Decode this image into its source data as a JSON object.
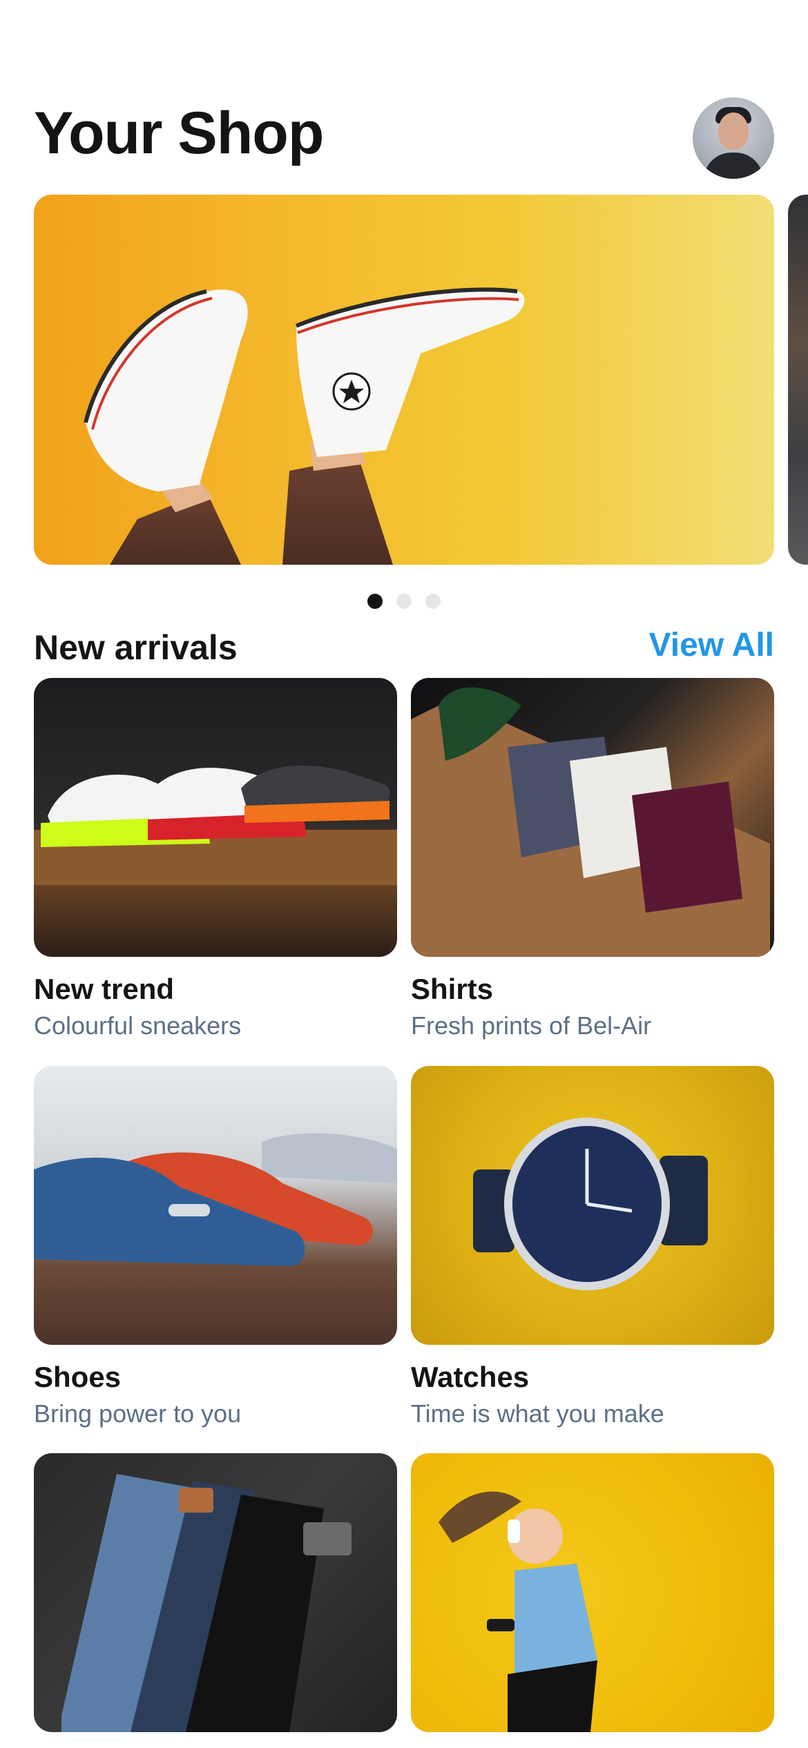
{
  "header": {
    "title": "Your Shop"
  },
  "hero": {
    "active_slide": 1,
    "total_slides": 3
  },
  "new_arrivals": {
    "title": "New arrivals",
    "view_all_label": "View All",
    "items": [
      {
        "name": "New trend",
        "subtitle": "Colourful sneakers"
      },
      {
        "name": "Shirts",
        "subtitle": "Fresh prints of Bel-Air"
      },
      {
        "name": "Shoes",
        "subtitle": "Bring power to you"
      },
      {
        "name": "Watches",
        "subtitle": "Time is what you make"
      },
      {
        "name": "",
        "subtitle": ""
      },
      {
        "name": "",
        "subtitle": ""
      }
    ]
  },
  "colors": {
    "accent": "#2196e8",
    "subtitle": "#5c6f86",
    "title": "#141414"
  },
  "icons": [
    "avatar"
  ]
}
